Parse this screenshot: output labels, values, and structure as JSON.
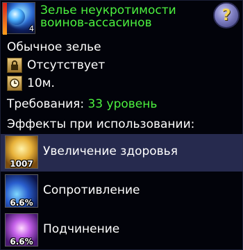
{
  "item": {
    "icon": "blue-potion-icon",
    "stack_count": "4",
    "title": "Зелье неукротимости воинов-ассасинов",
    "help_icon": "question-mark-icon",
    "help_label": "?",
    "rarity": "Обычное зелье",
    "binding": {
      "icon": "lock-icon",
      "text": "Отсутствует"
    },
    "duration": {
      "icon": "clock-icon",
      "text": "10м."
    },
    "requirement": {
      "label": "Требования:",
      "value": "33 уровень"
    },
    "effects_header": "Эффекты при использовании:"
  },
  "effects": [
    {
      "icon": "health-boost-icon",
      "badge": "1007",
      "label": "Увеличение здоровья",
      "selected": true
    },
    {
      "icon": "resistance-icon",
      "badge": "6.6%",
      "label": "Сопротивление",
      "selected": false
    },
    {
      "icon": "subjugation-icon",
      "badge": "6.6%",
      "label": "Подчинение",
      "selected": false
    }
  ],
  "colors": {
    "title": "#4cf23f",
    "requirement_value": "#4cf23f",
    "selected_row": "#262a4e",
    "background": "#02030a"
  }
}
